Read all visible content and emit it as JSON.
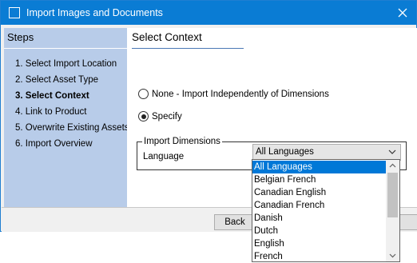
{
  "window": {
    "title": "Import Images and Documents"
  },
  "steps": {
    "header": "Steps",
    "items": [
      {
        "label": "1. Select Import Location"
      },
      {
        "label": "2. Select Asset Type"
      },
      {
        "label": "3. Select Context"
      },
      {
        "label": "4. Link to Product"
      },
      {
        "label": "5. Overwrite Existing Assets"
      },
      {
        "label": "6. Import Overview"
      }
    ],
    "current_index": 2
  },
  "content": {
    "title": "Select Context",
    "options": [
      {
        "label": "None - Import Independently of Dimensions",
        "checked": false
      },
      {
        "label": "Specify",
        "checked": true
      }
    ],
    "group": {
      "legend": "Import Dimensions",
      "language_label": "Language",
      "language_value": "All Languages"
    }
  },
  "dropdown": {
    "items": [
      "All Languages",
      "Belgian French",
      "Canadian English",
      "Canadian French",
      "Danish",
      "Dutch",
      "English",
      "French"
    ],
    "selected_index": 0
  },
  "buttons": {
    "back": "Back"
  },
  "colors": {
    "titlebar": "#0a7cd4",
    "steps_panel": "#b8cce9",
    "selection": "#0078d7"
  }
}
